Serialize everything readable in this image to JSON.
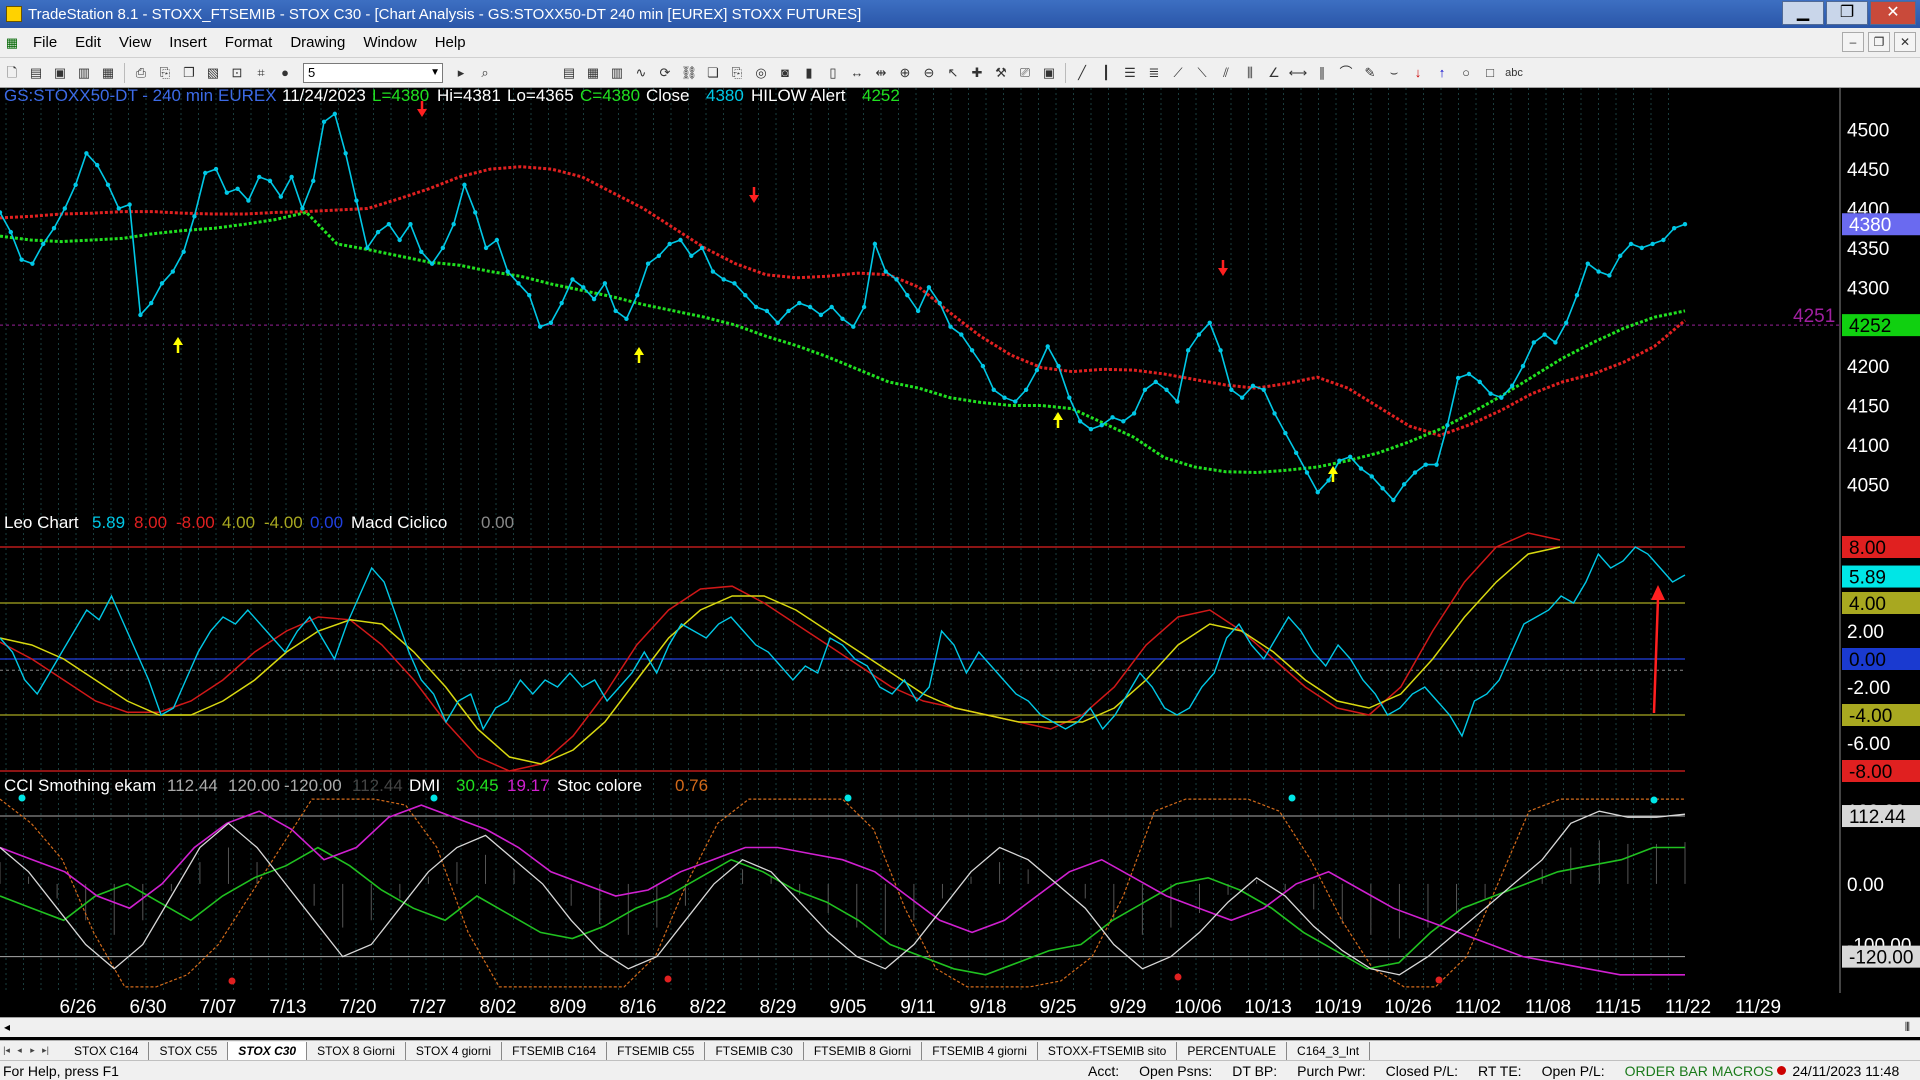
{
  "window": {
    "title": "TradeStation 8.1 - STOXX_FTSEMIB - STOX  C30 - [Chart Analysis - GS:STOXX50-DT  240 min  [EUREX] STOXX FUTURES]",
    "minimize": "▁",
    "maximize": "❐",
    "close": "✕"
  },
  "menu": [
    "File",
    "Edit",
    "View",
    "Insert",
    "Format",
    "Drawing",
    "Window",
    "Help"
  ],
  "mdi_controls": [
    "‒",
    "❐",
    "✕"
  ],
  "toolbar": {
    "interval_value": "5",
    "colors": {
      "bg": "#f0f0f0"
    }
  },
  "chart_data": [
    {
      "type": "line",
      "title": "GS:STOXX50-DT - 240 min",
      "header": {
        "symbol": "GS:STOXX50-DT - 240 min",
        "exchange": "EUREX",
        "date": "11/24/2023",
        "last": "L=4380",
        "hi": "Hi=4381",
        "lo": "Lo=4365",
        "close_c": "C=4380",
        "close_label": "Close",
        "close_value": "4380",
        "alert_label": "HILOW Alert",
        "alert_value": "4252"
      },
      "x_dates": [
        "6/26",
        "6/30",
        "7/07",
        "7/13",
        "7/20",
        "7/27",
        "8/02",
        "8/09",
        "8/16",
        "8/22",
        "8/29",
        "9/05",
        "9/11",
        "9/18",
        "9/25",
        "9/29",
        "10/06",
        "10/13",
        "10/19",
        "10/26",
        "11/02",
        "11/08",
        "11/15",
        "11/22",
        "11/29"
      ],
      "y_ticks": [
        "4500",
        "4450",
        "4400",
        "4350",
        "4300",
        "4250",
        "4200",
        "4150",
        "4100",
        "4050"
      ],
      "ylim": [
        4020,
        4530
      ],
      "last_price_label": "4380",
      "alert_level_label": "4252",
      "alert_line_left_label": "4251",
      "series": [
        {
          "name": "Close",
          "color": "#00c8e6",
          "values": [
            4395,
            4370,
            4335,
            4330,
            4355,
            4375,
            4400,
            4430,
            4470,
            4455,
            4430,
            4400,
            4405,
            4265,
            4280,
            4305,
            4320,
            4345,
            4390,
            4445,
            4450,
            4420,
            4425,
            4410,
            4440,
            4435,
            4415,
            4440,
            4400,
            4435,
            4510,
            4520,
            4470,
            4410,
            4350,
            4370,
            4380,
            4360,
            4380,
            4345,
            4330,
            4350,
            4380,
            4430,
            4395,
            4350,
            4360,
            4320,
            4305,
            4290,
            4250,
            4255,
            4280,
            4310,
            4300,
            4285,
            4305,
            4270,
            4260,
            4290,
            4330,
            4340,
            4355,
            4360,
            4340,
            4350,
            4320,
            4310,
            4305,
            4290,
            4275,
            4270,
            4255,
            4270,
            4280,
            4275,
            4265,
            4275,
            4260,
            4250,
            4275,
            4355,
            4320,
            4310,
            4290,
            4270,
            4300,
            4280,
            4250,
            4240,
            4220,
            4200,
            4170,
            4160,
            4155,
            4170,
            4195,
            4225,
            4200,
            4160,
            4130,
            4120,
            4125,
            4135,
            4130,
            4140,
            4170,
            4180,
            4170,
            4155,
            4220,
            4240,
            4255,
            4220,
            4170,
            4160,
            4175,
            4170,
            4140,
            4115,
            4090,
            4065,
            4040,
            4055,
            4080,
            4085,
            4070,
            4060,
            4045,
            4030,
            4050,
            4065,
            4075,
            4075,
            4125,
            4185,
            4190,
            4180,
            4165,
            4160,
            4175,
            4200,
            4230,
            4240,
            4230,
            4255,
            4290,
            4330,
            4320,
            4315,
            4340,
            4355,
            4350,
            4355,
            4360,
            4375,
            4380
          ]
        },
        {
          "name": "Moving Average (red)",
          "color": "#e02020",
          "values": [
            4388,
            4390,
            4393,
            4394,
            4396,
            4396,
            4394,
            4393,
            4393,
            4395,
            4396,
            4398,
            4400,
            4412,
            4425,
            4440,
            4450,
            4453,
            4450,
            4440,
            4420,
            4400,
            4375,
            4350,
            4330,
            4316,
            4312,
            4314,
            4318,
            4316,
            4300,
            4268,
            4238,
            4214,
            4198,
            4193,
            4196,
            4195,
            4190,
            4183,
            4176,
            4172,
            4178,
            4186,
            4172,
            4148,
            4124,
            4112,
            4126,
            4144,
            4165,
            4180,
            4190,
            4205,
            4225,
            4258
          ]
        },
        {
          "name": "Moving Average (green)",
          "color": "#20e020",
          "values": [
            4365,
            4360,
            4358,
            4360,
            4362,
            4368,
            4372,
            4375,
            4380,
            4386,
            4395,
            4355,
            4348,
            4340,
            4332,
            4328,
            4320,
            4314,
            4304,
            4296,
            4288,
            4278,
            4270,
            4262,
            4252,
            4238,
            4226,
            4212,
            4196,
            4180,
            4172,
            4160,
            4154,
            4150,
            4150,
            4146,
            4128,
            4110,
            4084,
            4072,
            4066,
            4065,
            4068,
            4072,
            4080,
            4090,
            4104,
            4120,
            4140,
            4162,
            4186,
            4210,
            4230,
            4248,
            4262,
            4270
          ]
        }
      ],
      "arrows": {
        "up": 5,
        "down": 4
      }
    },
    {
      "type": "line",
      "title": "Leo Chart",
      "header": {
        "name": "Leo Chart",
        "v1": "5.89",
        "v2": "8.00",
        "v3": "-8.00",
        "v4": "4.00",
        "v5": "-4.00",
        "v6": "0.00",
        "name2": "Macd Ciclico",
        "v7": "0.00"
      },
      "y_ticks": [
        "2.00",
        "-2.00",
        "-6.00"
      ],
      "level_labels": {
        "p8": "8.00",
        "last": "5.89",
        "p4": "4.00",
        "zero": "0.00",
        "m4": "-4.00",
        "m8": "-8.00"
      },
      "ylim": [
        -8.5,
        9
      ],
      "series": [
        {
          "name": "Leo Chart",
          "color": "#00c8e6",
          "values": [
            1.5,
            0.5,
            -1.5,
            -2.5,
            -1.0,
            0.5,
            2.0,
            3.5,
            2.8,
            4.5,
            2.5,
            0.5,
            -1.5,
            -4.0,
            -3.5,
            -1.5,
            0.5,
            2.0,
            3.0,
            2.5,
            3.5,
            2.5,
            1.5,
            0.5,
            2.0,
            3.0,
            1.5,
            0.0,
            2.5,
            4.5,
            6.5,
            5.5,
            3.0,
            0.5,
            -1.5,
            -2.5,
            -4.5,
            -3.0,
            -2.5,
            -5.0,
            -3.5,
            -3.0,
            -1.5,
            -2.5,
            -1.5,
            -2.0,
            -1.0,
            -2.0,
            -1.5,
            -3.0,
            -2.0,
            -1.0,
            0.5,
            -1.0,
            1.0,
            2.5,
            2.0,
            1.5,
            2.5,
            3.0,
            2.0,
            1.0,
            0.5,
            -0.5,
            -1.5,
            -0.5,
            -1.0,
            1.5,
            1.0,
            0.0,
            -0.5,
            -2.0,
            -2.5,
            -1.5,
            -3.0,
            -2.0,
            2.0,
            1.0,
            -1.0,
            0.5,
            -0.5,
            -1.5,
            -2.5,
            -3.0,
            -4.0,
            -4.5,
            -5.0,
            -4.5,
            -3.5,
            -5.0,
            -4.0,
            -2.5,
            -1.0,
            -2.0,
            -3.5,
            -4.0,
            -3.5,
            -2.0,
            -1.0,
            1.5,
            2.5,
            1.0,
            0.0,
            1.5,
            3.0,
            2.0,
            0.5,
            -0.5,
            1.0,
            0.0,
            -1.5,
            -2.5,
            -4.0,
            -3.5,
            -2.5,
            -2.0,
            -3.0,
            -4.0,
            -5.5,
            -3.0,
            -2.5,
            -1.5,
            0.5,
            2.5,
            3.0,
            3.5,
            4.5,
            4.0,
            5.5,
            7.5,
            6.5,
            7.0,
            8.0,
            7.5,
            6.5,
            5.5,
            6.0
          ]
        },
        {
          "name": "Red cycle",
          "color": "#d01818",
          "values": [
            1.2,
            0.0,
            -1.5,
            -3.0,
            -3.8,
            -3.8,
            -3.0,
            -1.5,
            0.5,
            2.0,
            3.0,
            2.8,
            1.0,
            -1.5,
            -4.5,
            -7.0,
            -8.0,
            -7.5,
            -5.5,
            -2.5,
            1.0,
            3.5,
            5.0,
            5.2,
            4.0,
            2.5,
            1.0,
            -0.5,
            -2.0,
            -3.0,
            -3.5,
            -4.0,
            -4.5,
            -5.0,
            -4.0,
            -2.0,
            1.0,
            3.0,
            3.5,
            2.0,
            0.0,
            -2.0,
            -3.5,
            -4.0,
            -2.0,
            2.0,
            5.5,
            8.0,
            9.0,
            8.5
          ]
        },
        {
          "name": "Yellow cycle",
          "color": "#d8d810",
          "values": [
            1.5,
            1.0,
            0.0,
            -1.5,
            -3.0,
            -4.0,
            -4.0,
            -3.0,
            -1.5,
            0.5,
            2.0,
            2.8,
            2.5,
            0.5,
            -2.0,
            -5.0,
            -7.0,
            -7.5,
            -6.5,
            -4.5,
            -1.5,
            1.5,
            3.5,
            4.5,
            4.5,
            3.5,
            2.0,
            0.5,
            -1.0,
            -2.5,
            -3.5,
            -4.0,
            -4.5,
            -4.5,
            -4.5,
            -3.5,
            -1.5,
            1.0,
            2.5,
            2.0,
            0.5,
            -1.5,
            -3.0,
            -3.5,
            -2.5,
            0.0,
            3.0,
            5.5,
            7.5,
            8.0
          ]
        }
      ]
    },
    {
      "type": "line",
      "title": "CCI Smothing ekam",
      "header": {
        "name": "CCI Smothing ekam",
        "v1": "112.44",
        "v2": "120.00",
        "v3": "-120.00",
        "v4": "112.44",
        "name2": "DMI",
        "v5": "30.45",
        "v6": "19.17",
        "name3": "Stoc colore",
        "v7": "0.76"
      },
      "y_ticks": [
        "120.00",
        "0.00",
        "-100.00"
      ],
      "level_labels": {
        "top": "112.44",
        "bottom": "-120.00"
      },
      "ylim": [
        -180,
        150
      ],
      "series": [
        {
          "name": "CCI",
          "color": "#d8d8d8",
          "values": [
            60,
            20,
            -40,
            -100,
            -140,
            -100,
            -20,
            60,
            100,
            60,
            0,
            -60,
            -120,
            -100,
            -40,
            20,
            60,
            80,
            40,
            0,
            -60,
            -110,
            -140,
            -120,
            -60,
            0,
            40,
            20,
            -30,
            -80,
            -120,
            -140,
            -100,
            -40,
            20,
            60,
            40,
            0,
            -40,
            -100,
            -140,
            -120,
            -80,
            -30,
            10,
            -20,
            -70,
            -110,
            -140,
            -150,
            -120,
            -80,
            -40,
            0,
            40,
            100,
            120,
            110,
            110,
            115
          ]
        },
        {
          "name": "DMI+",
          "color": "#20c020",
          "values": [
            -20,
            -40,
            -60,
            -20,
            0,
            -30,
            -60,
            -20,
            10,
            30,
            60,
            30,
            -10,
            -40,
            -60,
            -20,
            -50,
            -80,
            -90,
            -70,
            -40,
            -20,
            10,
            40,
            20,
            -10,
            -30,
            -60,
            -100,
            -120,
            -140,
            -150,
            -130,
            -110,
            -100,
            -60,
            -30,
            0,
            10,
            -10,
            -40,
            -80,
            -110,
            -140,
            -130,
            -80,
            -40,
            -20,
            0,
            20,
            30,
            40,
            60,
            60
          ]
        },
        {
          "name": "DMI-",
          "color": "#d020d0",
          "values": [
            60,
            40,
            20,
            -20,
            -40,
            0,
            60,
            100,
            120,
            90,
            40,
            60,
            110,
            130,
            110,
            90,
            60,
            20,
            0,
            -20,
            -10,
            20,
            40,
            60,
            60,
            50,
            40,
            20,
            -20,
            -60,
            -80,
            -60,
            -20,
            20,
            40,
            10,
            -20,
            -40,
            -60,
            -40,
            0,
            20,
            -10,
            -40,
            -60,
            -80,
            -100,
            -120,
            -130,
            -140,
            -150,
            -150,
            -150
          ]
        },
        {
          "name": "Stoc",
          "color": "#d26a1a",
          "values": [
            140,
            100,
            40,
            -80,
            -170,
            -170,
            -150,
            -100,
            -20,
            60,
            140,
            140,
            140,
            130,
            60,
            -80,
            -170,
            -170,
            -170,
            -170,
            -170,
            -120,
            0,
            100,
            140,
            140,
            140,
            140,
            90,
            -40,
            -140,
            -170,
            -170,
            -170,
            -160,
            -120,
            -20,
            120,
            140,
            140,
            140,
            120,
            40,
            -60,
            -140,
            -170,
            -170,
            -120,
            0,
            120,
            140,
            140,
            140,
            140,
            140
          ]
        }
      ]
    }
  ],
  "tabs": [
    "STOX C164",
    "STOX C55",
    "STOX  C30",
    "STOX  8 Giorni",
    "STOX 4 giorni",
    "FTSEMIB C164",
    "FTSEMIB C55",
    "FTSEMIB C30",
    "FTSEMIB  8 Giorni",
    "FTSEMIB  4 giorni",
    "STOXX-FTSEMIB sito",
    "PERCENTUALE",
    "C164_3_Int"
  ],
  "active_tab": 2,
  "status": {
    "help": "For Help, press F1",
    "acct": "Acct:",
    "open_psns": "Open Psns:",
    "dt_bp": "DT BP:",
    "purch_pwr": "Purch Pwr:",
    "closed_pl": "Closed P/L:",
    "rt_te": "RT TE:",
    "open_pl": "Open P/L:",
    "order_bar": "ORDER BAR",
    "macros": "MACROS",
    "datetime": "24/11/2023 11:48"
  },
  "colors": {
    "bg": "#000000",
    "grid": "#2e6e6e",
    "price": "#00c8e6",
    "ma_red": "#e02020",
    "ma_green": "#20e020",
    "alert_line": "#7a1a7a",
    "last_bg": "#6a6af0",
    "alert_bg": "#10d010"
  }
}
